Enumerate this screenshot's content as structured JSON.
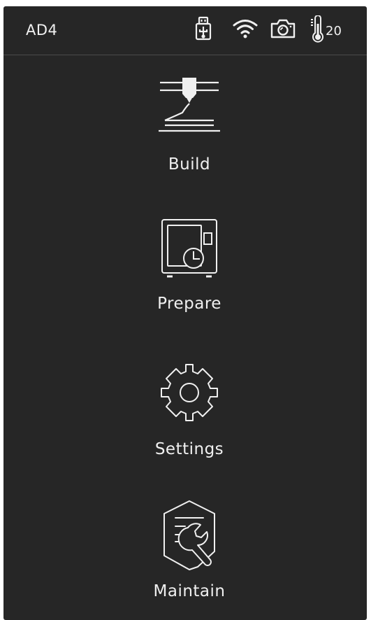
{
  "status_bar": {
    "device_name": "AD4",
    "temperature": "20",
    "icons": [
      "usb-icon",
      "wifi-icon",
      "camera-icon",
      "thermometer-icon"
    ]
  },
  "menu": {
    "items": [
      {
        "label": "Build",
        "icon": "printer-nozzle-icon"
      },
      {
        "label": "Prepare",
        "icon": "machine-clock-icon"
      },
      {
        "label": "Settings",
        "icon": "gear-icon"
      },
      {
        "label": "Maintain",
        "icon": "wrench-hexagon-icon"
      }
    ]
  },
  "colors": {
    "background": "#262626",
    "foreground": "#f0f0f0",
    "divider": "#4a4a4a"
  }
}
